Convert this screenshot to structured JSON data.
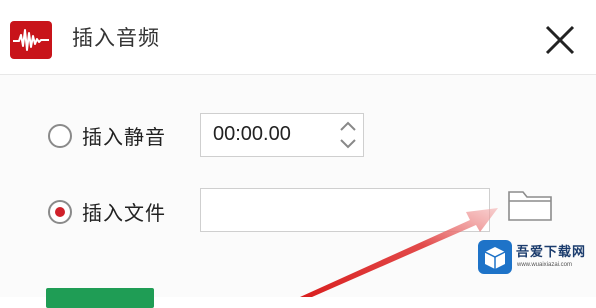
{
  "dialog": {
    "title": "插入音频",
    "close_icon": "close-icon",
    "app_icon": "audio-waveform-icon",
    "brand_color": "#c8141a"
  },
  "options": {
    "silence": {
      "label": "插入静音",
      "selected": false,
      "time_value": "00:00.00"
    },
    "file": {
      "label": "插入文件",
      "selected": true,
      "path_value": "",
      "folder_icon": "folder-icon"
    }
  },
  "colors": {
    "radio_selected": "#d0202a",
    "arrow": "#e23a3a",
    "ok_button": "#1f9d55"
  },
  "watermark": {
    "name": "吾爱下载网",
    "url": "www.wuaixiazai.com"
  }
}
